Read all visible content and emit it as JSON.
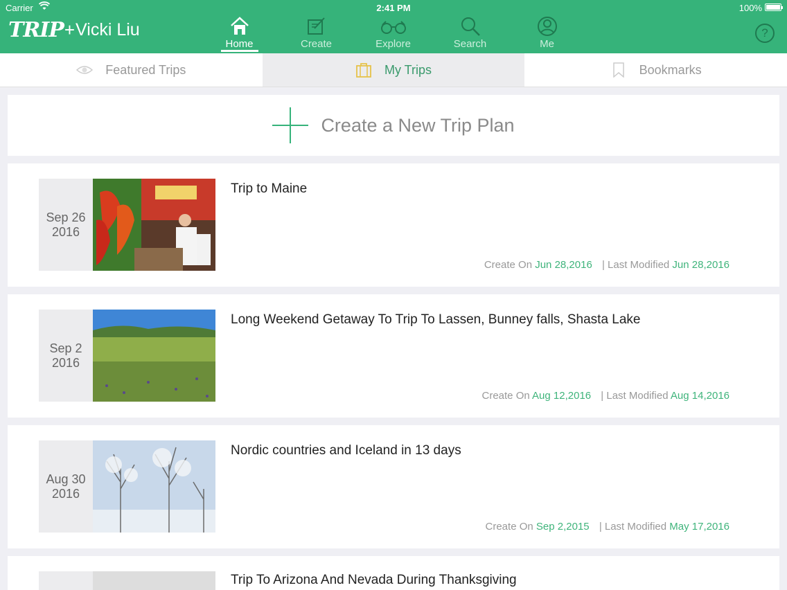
{
  "status": {
    "carrier": "Carrier",
    "time": "2:41 PM",
    "battery": "100%"
  },
  "header": {
    "brand": "TRIP",
    "plus": "+",
    "user": "Vicki Liu",
    "nav": [
      {
        "label": "Home",
        "icon": "home-icon",
        "active": true
      },
      {
        "label": "Create",
        "icon": "create-icon"
      },
      {
        "label": "Explore",
        "icon": "binoculars-icon"
      },
      {
        "label": "Search",
        "icon": "search-icon"
      },
      {
        "label": "Me",
        "icon": "profile-icon"
      }
    ],
    "help": "?"
  },
  "tabs": [
    {
      "label": "Featured Trips",
      "icon": "eye-icon"
    },
    {
      "label": "My Trips",
      "icon": "suitcase-icon",
      "active": true
    },
    {
      "label": "Bookmarks",
      "icon": "bookmark-icon"
    }
  ],
  "create": {
    "label": "Create a New Trip Plan"
  },
  "meta_labels": {
    "created": "Create On",
    "modified": "| Last Modified"
  },
  "trips": [
    {
      "date_md": "Sep 26",
      "date_y": "2016",
      "title": "Trip to Maine",
      "created": "Jun 28,2016",
      "modified": "Jun 28,2016"
    },
    {
      "date_md": "Sep 2",
      "date_y": "2016",
      "title": "Long Weekend Getaway To Trip To Lassen, Bunney falls, Shasta Lake",
      "created": "Aug 12,2016",
      "modified": "Aug 14,2016"
    },
    {
      "date_md": "Aug 30",
      "date_y": "2016",
      "title": "Nordic countries and Iceland in 13 days",
      "created": "Sep 2,2015",
      "modified": "May 17,2016"
    },
    {
      "date_md": "",
      "date_y": "",
      "title": "Trip To Arizona And Nevada During Thanksgiving",
      "created": "",
      "modified": ""
    }
  ],
  "colors": {
    "brand_green": "#36b37a",
    "accent_green": "#3fb47b",
    "tab_active_text": "#3a9a6c"
  }
}
